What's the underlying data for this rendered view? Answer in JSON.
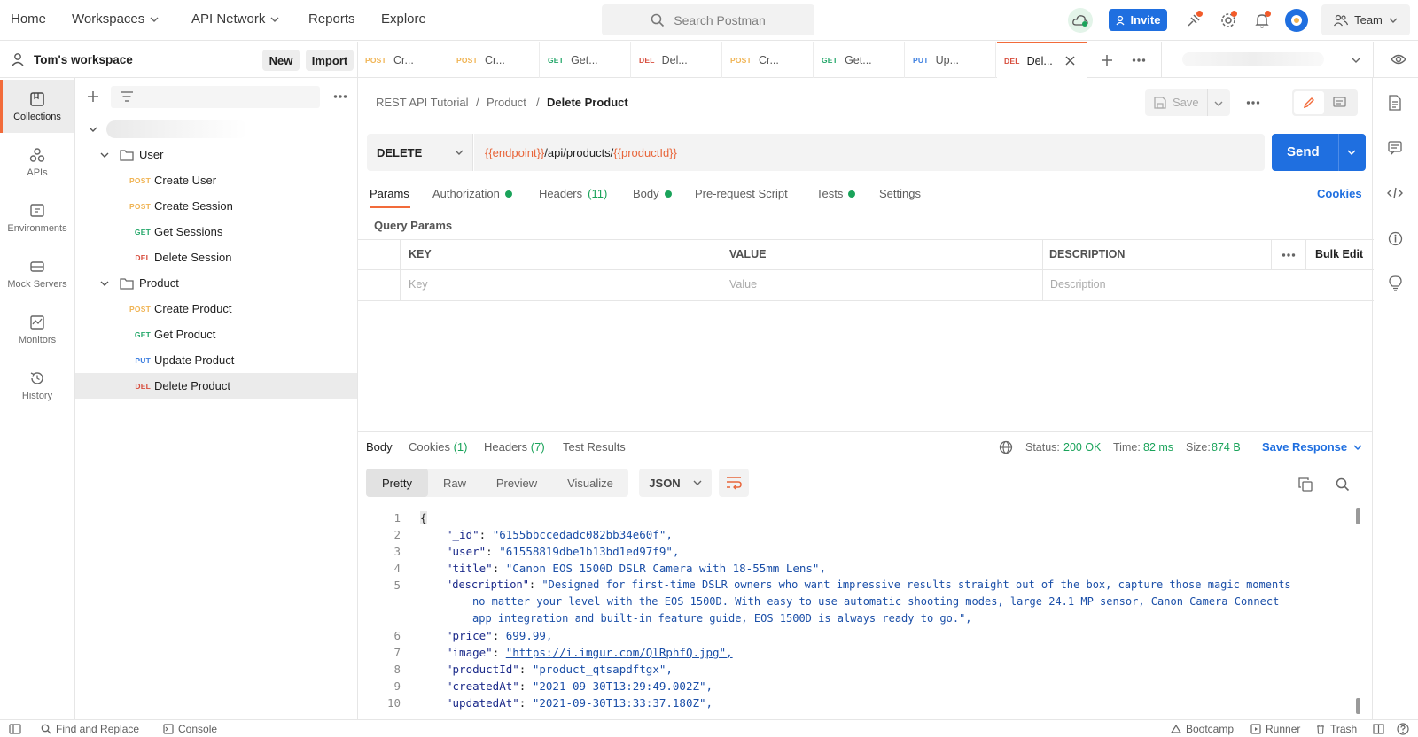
{
  "nav": {
    "home": "Home",
    "workspaces": "Workspaces",
    "api_network": "API Network",
    "reports": "Reports",
    "explore": "Explore",
    "search_placeholder": "Search Postman",
    "invite": "Invite",
    "team": "Team"
  },
  "workspace": {
    "name": "Tom's workspace",
    "new": "New",
    "import": "Import"
  },
  "rail": [
    {
      "label": "Collections",
      "icon": "collections-icon"
    },
    {
      "label": "APIs",
      "icon": "apis-icon"
    },
    {
      "label": "Environments",
      "icon": "environments-icon"
    },
    {
      "label": "Mock Servers",
      "icon": "mock-servers-icon"
    },
    {
      "label": "Monitors",
      "icon": "monitors-icon"
    },
    {
      "label": "History",
      "icon": "history-icon"
    }
  ],
  "tree": {
    "folders": [
      {
        "name": "User",
        "items": [
          {
            "method": "POST",
            "name": "Create User"
          },
          {
            "method": "POST",
            "name": "Create Session"
          },
          {
            "method": "GET",
            "name": "Get Sessions"
          },
          {
            "method": "DEL",
            "name": "Delete Session"
          }
        ]
      },
      {
        "name": "Product",
        "items": [
          {
            "method": "POST",
            "name": "Create Product"
          },
          {
            "method": "GET",
            "name": "Get Product"
          },
          {
            "method": "PUT",
            "name": "Update Product"
          },
          {
            "method": "DEL",
            "name": "Delete Product"
          }
        ]
      }
    ]
  },
  "tabs": [
    {
      "method": "POST",
      "label": "Cr..."
    },
    {
      "method": "POST",
      "label": "Cr..."
    },
    {
      "method": "GET",
      "label": "Get..."
    },
    {
      "method": "DEL",
      "label": "Del..."
    },
    {
      "method": "POST",
      "label": "Cr..."
    },
    {
      "method": "GET",
      "label": "Get..."
    },
    {
      "method": "PUT",
      "label": "Up..."
    },
    {
      "method": "DEL",
      "label": "Del..."
    }
  ],
  "breadcrumb": {
    "collection": "REST API Tutorial",
    "sep": "/",
    "folder": "Product",
    "current": "Delete Product"
  },
  "save": "Save",
  "request": {
    "method": "DELETE",
    "url_var1": "{{endpoint}}",
    "url_path": "/api/products/",
    "url_var2": "{{productId}}",
    "send": "Send"
  },
  "req_tabs": {
    "params": "Params",
    "authorization": "Authorization",
    "headers": "Headers",
    "headers_count": "(11)",
    "body": "Body",
    "prerequest": "Pre-request Script",
    "tests": "Tests",
    "settings": "Settings",
    "cookies": "Cookies"
  },
  "query_params": {
    "title": "Query Params",
    "col_key": "KEY",
    "col_value": "VALUE",
    "col_description": "DESCRIPTION",
    "bulk_edit": "Bulk Edit",
    "ph_key": "Key",
    "ph_value": "Value",
    "ph_description": "Description"
  },
  "response": {
    "tab_body": "Body",
    "tab_cookies": "Cookies",
    "cookies_count": "(1)",
    "tab_headers": "Headers",
    "headers_count": "(7)",
    "tab_tests": "Test Results",
    "status_label": "Status:",
    "status_value": "200 OK",
    "time_label": "Time:",
    "time_value": "82 ms",
    "size_label": "Size:",
    "size_value": "874 B",
    "save_response": "Save Response",
    "views": [
      "Pretty",
      "Raw",
      "Preview",
      "Visualize"
    ],
    "format": "JSON"
  },
  "json_lines": [
    {
      "n": "1",
      "text": "{"
    },
    {
      "n": "2",
      "key": "\"_id\"",
      "val": "\"6155bbccedadc082bb34e60f\","
    },
    {
      "n": "3",
      "key": "\"user\"",
      "val": "\"61558819dbe1b13bd1ed97f9\","
    },
    {
      "n": "4",
      "key": "\"title\"",
      "val": "\"Canon EOS 1500D DSLR Camera with 18-55mm Lens\","
    },
    {
      "n": "5",
      "key": "\"description\"",
      "val": "\"Designed for first-time DSLR owners who want impressive results straight out of the box, capture those magic moments",
      "cont1": "no matter your level with the EOS 1500D. With easy to use automatic shooting modes, large 24.1 MP sensor, Canon Camera Connect",
      "cont2": "app integration and built-in feature guide, EOS 1500D is always ready to go.\","
    },
    {
      "n": "6",
      "key": "\"price\"",
      "val": "699.99,"
    },
    {
      "n": "7",
      "key": "\"image\"",
      "val": "\"https://i.imgur.com/QlRphfQ.jpg\","
    },
    {
      "n": "8",
      "key": "\"productId\"",
      "val": "\"product_qtsapdftgx\","
    },
    {
      "n": "9",
      "key": "\"createdAt\"",
      "val": "\"2021-09-30T13:29:49.002Z\","
    },
    {
      "n": "10",
      "key": "\"updatedAt\"",
      "val": "\"2021-09-30T13:33:37.180Z\","
    }
  ],
  "footer": {
    "find_replace": "Find and Replace",
    "console": "Console",
    "bootcamp": "Bootcamp",
    "runner": "Runner",
    "trash": "Trash"
  },
  "colors": {
    "accent_orange": "#f26b3a",
    "primary_blue": "#1f6fe0",
    "status_green": "#1aa35a",
    "var_orange": "#e8663b"
  }
}
